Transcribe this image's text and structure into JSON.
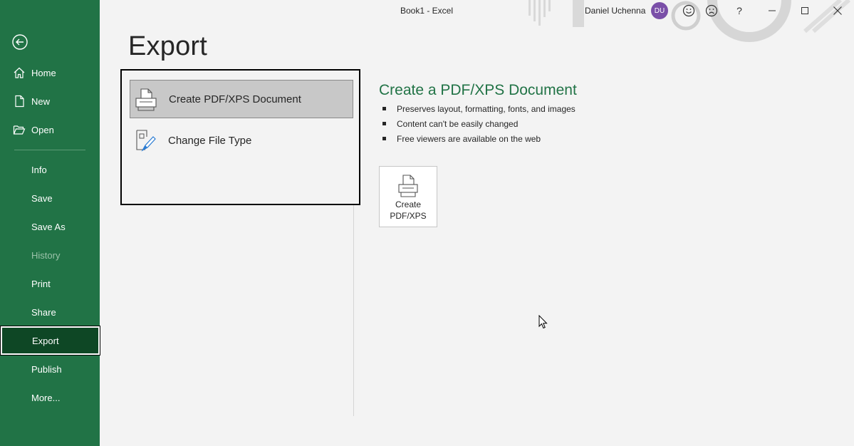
{
  "window": {
    "title": "Book1  -  Excel",
    "user_name": "Daniel Uchenna",
    "user_initials": "DU",
    "help_label": "?"
  },
  "sidebar": {
    "items": [
      {
        "label": "Home",
        "icon": "home-icon"
      },
      {
        "label": "New",
        "icon": "new-document-icon"
      },
      {
        "label": "Open",
        "icon": "open-folder-icon"
      },
      {
        "label": "Info"
      },
      {
        "label": "Save"
      },
      {
        "label": "Save As"
      },
      {
        "label": "History",
        "disabled": true
      },
      {
        "label": "Print"
      },
      {
        "label": "Share"
      },
      {
        "label": "Export",
        "active": true
      },
      {
        "label": "Publish"
      },
      {
        "label": "More..."
      }
    ]
  },
  "main": {
    "page_title": "Export",
    "options": [
      {
        "label": "Create PDF/XPS Document",
        "icon": "pdf-document-icon",
        "selected": true
      },
      {
        "label": "Change File Type",
        "icon": "change-file-type-icon",
        "selected": false
      }
    ],
    "detail": {
      "title": "Create a PDF/XPS Document",
      "bullets": [
        "Preserves layout, formatting, fonts, and images",
        "Content can't be easily changed",
        "Free viewers are available on the web"
      ],
      "button_label_line1": "Create",
      "button_label_line2": "PDF/XPS"
    }
  },
  "colors": {
    "accent": "#217346",
    "active_nav": "#0e4725",
    "avatar": "#7a4fa8"
  }
}
